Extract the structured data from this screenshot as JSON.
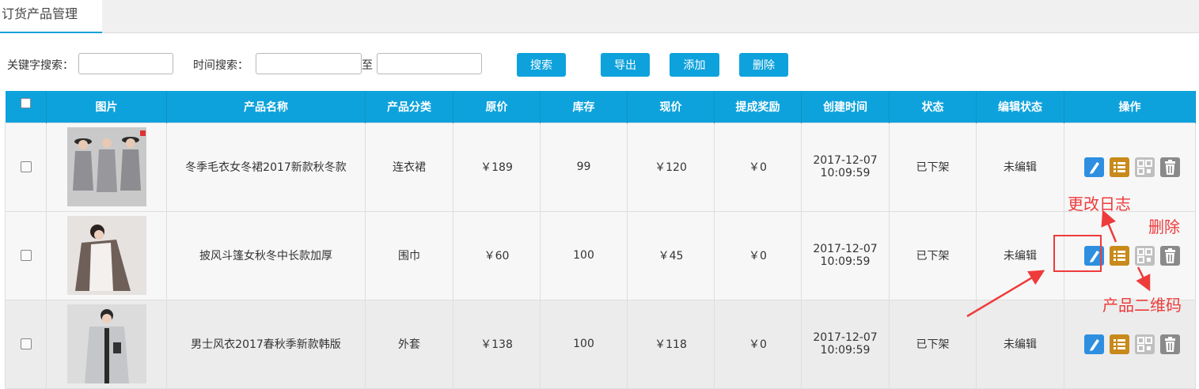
{
  "tab": {
    "label": "订货产品管理"
  },
  "search": {
    "keyword_label": "关键字搜索：",
    "keyword_value": "",
    "time_label": "时间搜索：",
    "time_from": "",
    "to_label": "至",
    "time_to": ""
  },
  "toolbar": {
    "search": "搜索",
    "export": "导出",
    "add": "添加",
    "delete": "删除"
  },
  "table": {
    "headers": [
      "",
      "图片",
      "产品名称",
      "产品分类",
      "原价",
      "库存",
      "现价",
      "提成奖励",
      "创建时间",
      "状态",
      "编辑状态",
      "操作"
    ],
    "rows": [
      {
        "name": "冬季毛衣女冬裙2017新款秋冬款",
        "category": "连衣裙",
        "orig_price": "￥189",
        "stock": "99",
        "price": "￥120",
        "bonus": "￥0",
        "date": "2017-12-07",
        "time": "10:09:59",
        "status": "已下架",
        "edit_status": "未编辑"
      },
      {
        "name": "披风斗篷女秋冬中长款加厚",
        "category": "围巾",
        "orig_price": "￥60",
        "stock": "100",
        "price": "￥45",
        "bonus": "￥0",
        "date": "2017-12-07",
        "time": "10:09:59",
        "status": "已下架",
        "edit_status": "未编辑"
      },
      {
        "name": "男士风衣2017春秋季新款韩版",
        "category": "外套",
        "orig_price": "￥138",
        "stock": "100",
        "price": "￥118",
        "bonus": "￥0",
        "date": "2017-12-07",
        "time": "10:09:59",
        "status": "已下架",
        "edit_status": "未编辑"
      }
    ]
  },
  "annotations": {
    "change_log": "更改日志",
    "delete": "删除",
    "qr_code": "产品二维码"
  },
  "colors": {
    "accent": "#0ea2dc",
    "annotation": "#ee3b3b"
  }
}
